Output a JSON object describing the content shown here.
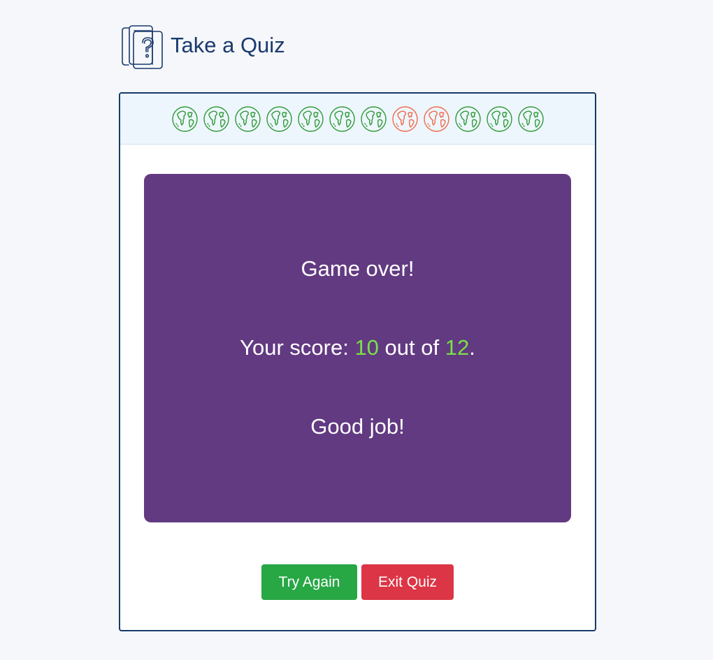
{
  "header": {
    "title": "Take a Quiz",
    "logo_icon": "question-cards-icon"
  },
  "progress": {
    "items": [
      {
        "icon": "globe-icon",
        "status": "correct"
      },
      {
        "icon": "globe-icon",
        "status": "correct"
      },
      {
        "icon": "globe-icon",
        "status": "correct"
      },
      {
        "icon": "globe-icon",
        "status": "correct"
      },
      {
        "icon": "globe-icon",
        "status": "correct"
      },
      {
        "icon": "globe-icon",
        "status": "correct"
      },
      {
        "icon": "globe-icon",
        "status": "correct"
      },
      {
        "icon": "globe-icon",
        "status": "incorrect"
      },
      {
        "icon": "globe-icon",
        "status": "incorrect"
      },
      {
        "icon": "globe-icon",
        "status": "correct"
      },
      {
        "icon": "globe-icon",
        "status": "correct"
      },
      {
        "icon": "globe-icon",
        "status": "correct"
      }
    ]
  },
  "result": {
    "game_over": "Game over!",
    "score_prefix": "Your score: ",
    "score": "10",
    "score_middle": " out of ",
    "total": "12",
    "score_suffix": ".",
    "message": "Good job!"
  },
  "buttons": {
    "try_again": "Try Again",
    "exit": "Exit Quiz"
  },
  "colors": {
    "correct": "#2e9a36",
    "incorrect": "#ef6a4a",
    "panel": "#623a81",
    "score_highlight": "#7be046",
    "title": "#1a3a6e",
    "try_again": "#28a745",
    "exit": "#dc3545"
  }
}
